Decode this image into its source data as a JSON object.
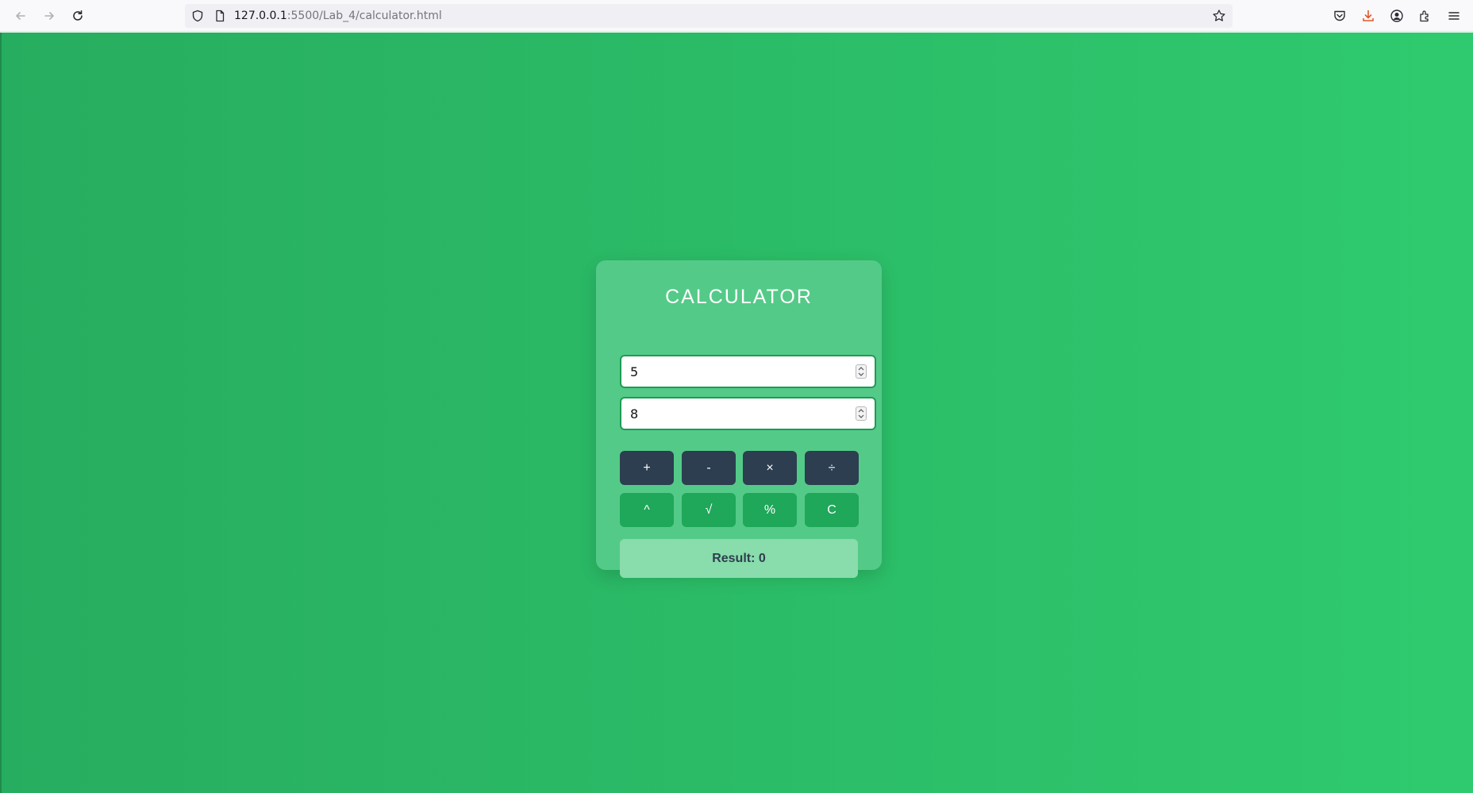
{
  "browser": {
    "url_host": "127.0.0.1",
    "url_rest": ":5500/Lab_4/calculator.html"
  },
  "calculator": {
    "title": "CALCULATOR",
    "input1_value": "5",
    "input2_value": "8",
    "buttons_row1": [
      "+",
      "-",
      "×",
      "÷"
    ],
    "buttons_row2": [
      "^",
      "√",
      "%",
      "C"
    ],
    "result_text": "Result: 0"
  },
  "colors": {
    "background_start": "#27ad5f",
    "background_end": "#2fca6f",
    "card": "#54ca88",
    "dark_button": "#2c3e50",
    "green_button": "#1fa75a",
    "result_box": "#89dcab"
  }
}
